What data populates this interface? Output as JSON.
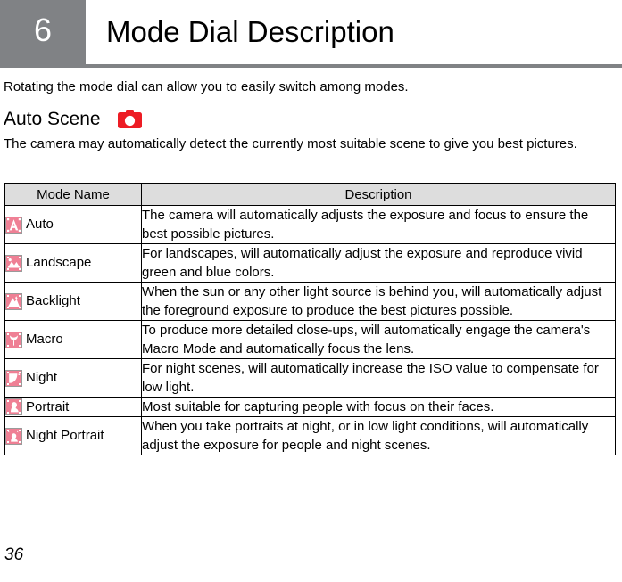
{
  "header": {
    "chapter_number": "6",
    "title": "Mode Dial Description",
    "band_color": "#808285"
  },
  "intro": {
    "text": "Rotating the mode dial can allow you to easily switch among modes."
  },
  "section": {
    "heading": "Auto Scene",
    "icon": "camera-icon",
    "icon_color": "#ed1c24",
    "body": "The camera may automatically detect the currently most suitable scene to give you best pictures."
  },
  "table": {
    "columns": [
      "Mode Name",
      "Description"
    ],
    "header_background": "#dddddd",
    "icon_color": "#ef8095",
    "rows": [
      {
        "icon": "auto-mode-icon",
        "mode": "Auto",
        "description": "The camera will automatically adjusts the exposure and focus to ensure the best possible pictures."
      },
      {
        "icon": "landscape-mode-icon",
        "mode": "Landscape",
        "description": "For landscapes, will automatically adjust the exposure and reproduce vivid green and blue colors."
      },
      {
        "icon": "backlight-mode-icon",
        "mode": "Backlight",
        "description": "When the sun or any other light source is behind you, will automatically adjust the foreground exposure to produce the best pictures possible."
      },
      {
        "icon": "macro-mode-icon",
        "mode": "Macro",
        "description": "To produce more detailed close-ups, will automatically engage the camera's Macro Mode and automatically focus the lens."
      },
      {
        "icon": "night-mode-icon",
        "mode": "Night",
        "description": "For night scenes, will automatically increase the ISO value to compensate for low light."
      },
      {
        "icon": "portrait-mode-icon",
        "mode": "Portrait",
        "description": "Most suitable for capturing people with focus on their faces."
      },
      {
        "icon": "night-portrait-mode-icon",
        "mode": "Night Portrait",
        "description": "When you take portraits at night, or in low light conditions, will automatically adjust the exposure for people and night scenes."
      }
    ]
  },
  "footer": {
    "page_number": "36"
  }
}
